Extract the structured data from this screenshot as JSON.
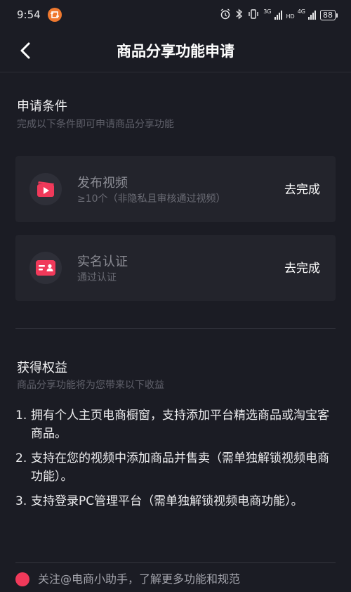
{
  "status_bar": {
    "time": "9:54",
    "network_1": "3G",
    "network_2": "HD",
    "network_3": "4G",
    "battery": "88"
  },
  "nav": {
    "title": "商品分享功能申请"
  },
  "conditions": {
    "title": "申请条件",
    "subtitle": "完成以下条件即可申请商品分享功能",
    "items": [
      {
        "title": "发布视频",
        "desc": "≥10个（非隐私且审核通过视频）",
        "action": "去完成",
        "icon": "video-clapper-icon"
      },
      {
        "title": "实名认证",
        "desc": "通过认证",
        "action": "去完成",
        "icon": "id-card-icon"
      }
    ]
  },
  "benefits": {
    "title": "获得权益",
    "subtitle": "商品分享功能将为您带来以下收益",
    "items": [
      {
        "num": "1.",
        "text": "拥有个人主页电商橱窗，支持添加平台精选商品或淘宝客商品。"
      },
      {
        "num": "2.",
        "text": "支持在您的视频中添加商品并售卖（需单独解锁视频电商功能）。"
      },
      {
        "num": "3.",
        "text": "支持登录PC管理平台（需单独解锁视频电商功能）。"
      }
    ]
  },
  "footer": {
    "text": "关注@电商小助手，了解更多功能和规范"
  },
  "colors": {
    "background": "#1b1c24",
    "card": "#23242c",
    "accent": "#f0395a"
  }
}
